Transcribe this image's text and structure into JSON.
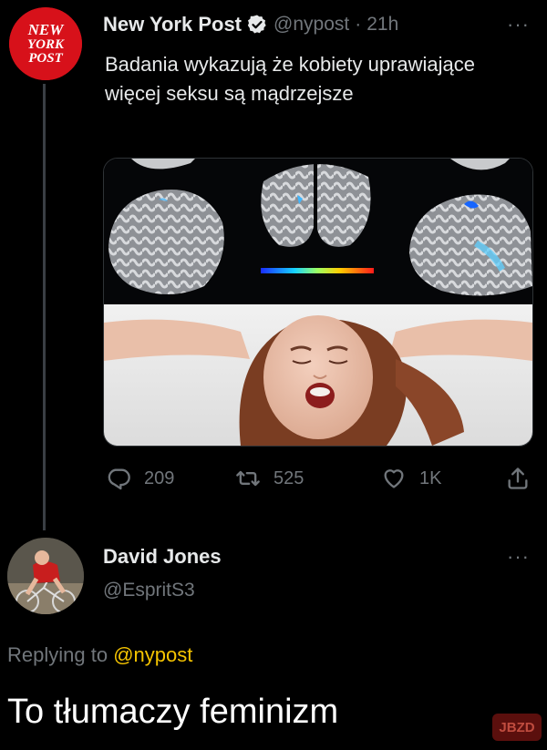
{
  "tweet": {
    "author_name": "New York Post",
    "handle": "@nypost",
    "separator": "·",
    "time": "21h",
    "more": "···",
    "logo_lines": [
      "NEW",
      "YORK",
      "POST"
    ],
    "text": "Badania wykazują że kobiety uprawiające więcej seksu są mądrzejsze",
    "actions": {
      "reply_count": "209",
      "retweet_count": "525",
      "like_count": "1K"
    },
    "colors": {
      "brand_red": "#d7111a",
      "verified_blue": "#1d9bf0"
    }
  },
  "reply": {
    "author_name": "David Jones",
    "handle": "@EspritS3",
    "more": "···",
    "replying_prefix": "Replying to",
    "replying_mention": "@nypost",
    "text": "To tłumaczy feminizm"
  },
  "watermark": {
    "text": "JBZD"
  },
  "icons": [
    "verified-badge-icon",
    "reply-icon",
    "retweet-icon",
    "like-icon",
    "share-icon",
    "more-icon"
  ]
}
